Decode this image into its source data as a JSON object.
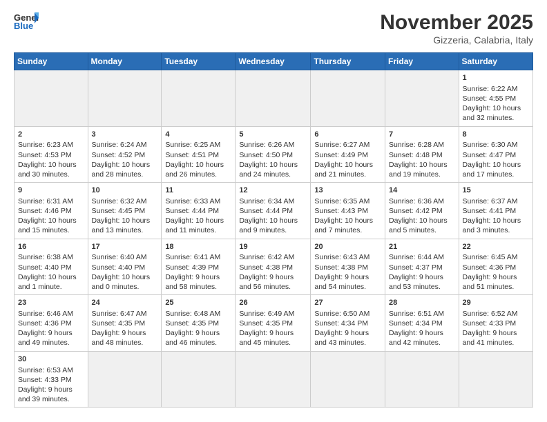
{
  "header": {
    "logo_general": "General",
    "logo_blue": "Blue",
    "month_title": "November 2025",
    "location": "Gizzeria, Calabria, Italy"
  },
  "weekdays": [
    "Sunday",
    "Monday",
    "Tuesday",
    "Wednesday",
    "Thursday",
    "Friday",
    "Saturday"
  ],
  "weeks": [
    [
      {
        "day": "",
        "empty": true
      },
      {
        "day": "",
        "empty": true
      },
      {
        "day": "",
        "empty": true
      },
      {
        "day": "",
        "empty": true
      },
      {
        "day": "",
        "empty": true
      },
      {
        "day": "",
        "empty": true
      },
      {
        "day": "1",
        "sunrise": "6:22 AM",
        "sunset": "4:55 PM",
        "daylight": "10 hours and 32 minutes."
      }
    ],
    [
      {
        "day": "2",
        "sunrise": "6:23 AM",
        "sunset": "4:53 PM",
        "daylight": "10 hours and 30 minutes."
      },
      {
        "day": "3",
        "sunrise": "6:24 AM",
        "sunset": "4:52 PM",
        "daylight": "10 hours and 28 minutes."
      },
      {
        "day": "4",
        "sunrise": "6:25 AM",
        "sunset": "4:51 PM",
        "daylight": "10 hours and 26 minutes."
      },
      {
        "day": "5",
        "sunrise": "6:26 AM",
        "sunset": "4:50 PM",
        "daylight": "10 hours and 24 minutes."
      },
      {
        "day": "6",
        "sunrise": "6:27 AM",
        "sunset": "4:49 PM",
        "daylight": "10 hours and 21 minutes."
      },
      {
        "day": "7",
        "sunrise": "6:28 AM",
        "sunset": "4:48 PM",
        "daylight": "10 hours and 19 minutes."
      },
      {
        "day": "8",
        "sunrise": "6:30 AM",
        "sunset": "4:47 PM",
        "daylight": "10 hours and 17 minutes."
      }
    ],
    [
      {
        "day": "9",
        "sunrise": "6:31 AM",
        "sunset": "4:46 PM",
        "daylight": "10 hours and 15 minutes."
      },
      {
        "day": "10",
        "sunrise": "6:32 AM",
        "sunset": "4:45 PM",
        "daylight": "10 hours and 13 minutes."
      },
      {
        "day": "11",
        "sunrise": "6:33 AM",
        "sunset": "4:44 PM",
        "daylight": "10 hours and 11 minutes."
      },
      {
        "day": "12",
        "sunrise": "6:34 AM",
        "sunset": "4:44 PM",
        "daylight": "10 hours and 9 minutes."
      },
      {
        "day": "13",
        "sunrise": "6:35 AM",
        "sunset": "4:43 PM",
        "daylight": "10 hours and 7 minutes."
      },
      {
        "day": "14",
        "sunrise": "6:36 AM",
        "sunset": "4:42 PM",
        "daylight": "10 hours and 5 minutes."
      },
      {
        "day": "15",
        "sunrise": "6:37 AM",
        "sunset": "4:41 PM",
        "daylight": "10 hours and 3 minutes."
      }
    ],
    [
      {
        "day": "16",
        "sunrise": "6:38 AM",
        "sunset": "4:40 PM",
        "daylight": "10 hours and 1 minute."
      },
      {
        "day": "17",
        "sunrise": "6:40 AM",
        "sunset": "4:40 PM",
        "daylight": "10 hours and 0 minutes."
      },
      {
        "day": "18",
        "sunrise": "6:41 AM",
        "sunset": "4:39 PM",
        "daylight": "9 hours and 58 minutes."
      },
      {
        "day": "19",
        "sunrise": "6:42 AM",
        "sunset": "4:38 PM",
        "daylight": "9 hours and 56 minutes."
      },
      {
        "day": "20",
        "sunrise": "6:43 AM",
        "sunset": "4:38 PM",
        "daylight": "9 hours and 54 minutes."
      },
      {
        "day": "21",
        "sunrise": "6:44 AM",
        "sunset": "4:37 PM",
        "daylight": "9 hours and 53 minutes."
      },
      {
        "day": "22",
        "sunrise": "6:45 AM",
        "sunset": "4:36 PM",
        "daylight": "9 hours and 51 minutes."
      }
    ],
    [
      {
        "day": "23",
        "sunrise": "6:46 AM",
        "sunset": "4:36 PM",
        "daylight": "9 hours and 49 minutes."
      },
      {
        "day": "24",
        "sunrise": "6:47 AM",
        "sunset": "4:35 PM",
        "daylight": "9 hours and 48 minutes."
      },
      {
        "day": "25",
        "sunrise": "6:48 AM",
        "sunset": "4:35 PM",
        "daylight": "9 hours and 46 minutes."
      },
      {
        "day": "26",
        "sunrise": "6:49 AM",
        "sunset": "4:35 PM",
        "daylight": "9 hours and 45 minutes."
      },
      {
        "day": "27",
        "sunrise": "6:50 AM",
        "sunset": "4:34 PM",
        "daylight": "9 hours and 43 minutes."
      },
      {
        "day": "28",
        "sunrise": "6:51 AM",
        "sunset": "4:34 PM",
        "daylight": "9 hours and 42 minutes."
      },
      {
        "day": "29",
        "sunrise": "6:52 AM",
        "sunset": "4:33 PM",
        "daylight": "9 hours and 41 minutes."
      }
    ],
    [
      {
        "day": "30",
        "sunrise": "6:53 AM",
        "sunset": "4:33 PM",
        "daylight": "9 hours and 39 minutes."
      },
      {
        "day": "",
        "empty": true
      },
      {
        "day": "",
        "empty": true
      },
      {
        "day": "",
        "empty": true
      },
      {
        "day": "",
        "empty": true
      },
      {
        "day": "",
        "empty": true
      },
      {
        "day": "",
        "empty": true
      }
    ]
  ]
}
